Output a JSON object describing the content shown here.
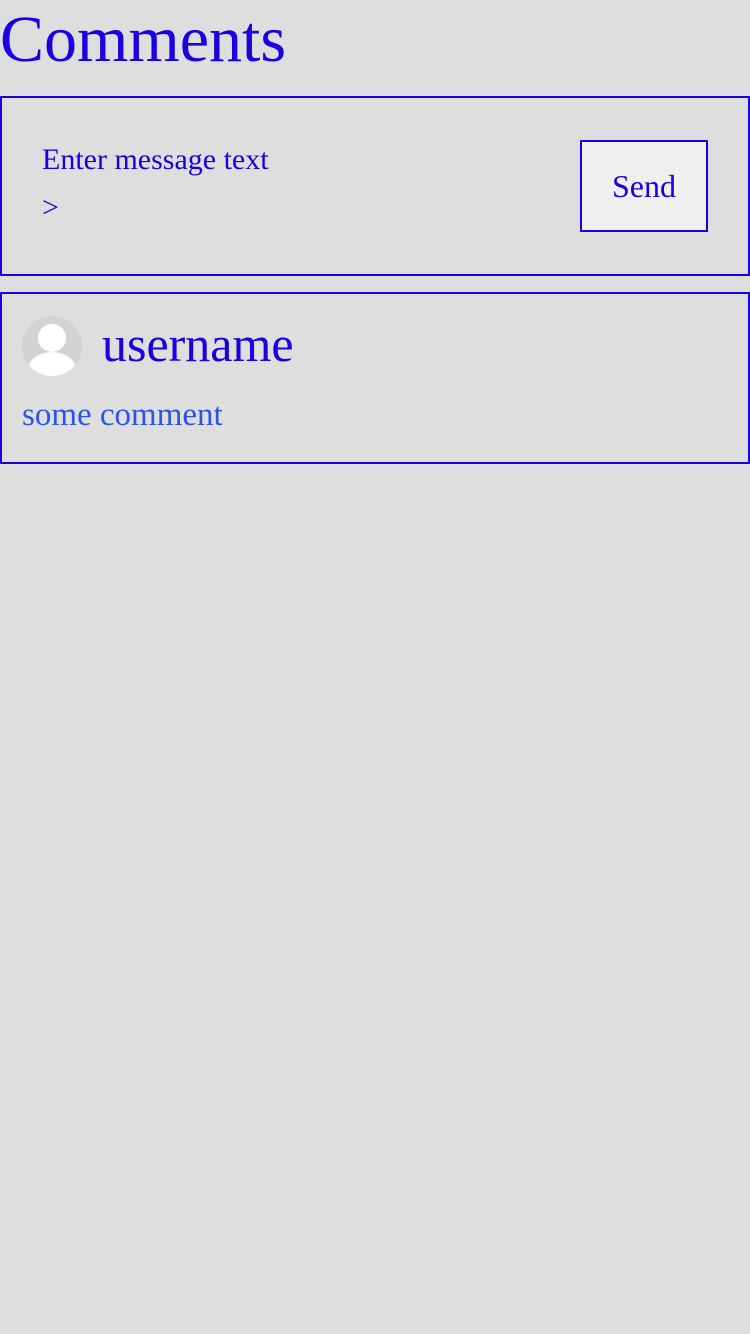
{
  "header": {
    "title": "Comments"
  },
  "composer": {
    "placeholder": "Enter message text >",
    "value": "",
    "send_label": "Send"
  },
  "comments": [
    {
      "username": "username",
      "text": "some comment",
      "avatar_icon": "default-user-avatar-icon"
    }
  ],
  "colors": {
    "background": "#dedede",
    "primary": "#1a00e0",
    "comment_text": "#2a55e6",
    "button_background": "#efefef",
    "avatar_background": "#d3d3d3"
  }
}
